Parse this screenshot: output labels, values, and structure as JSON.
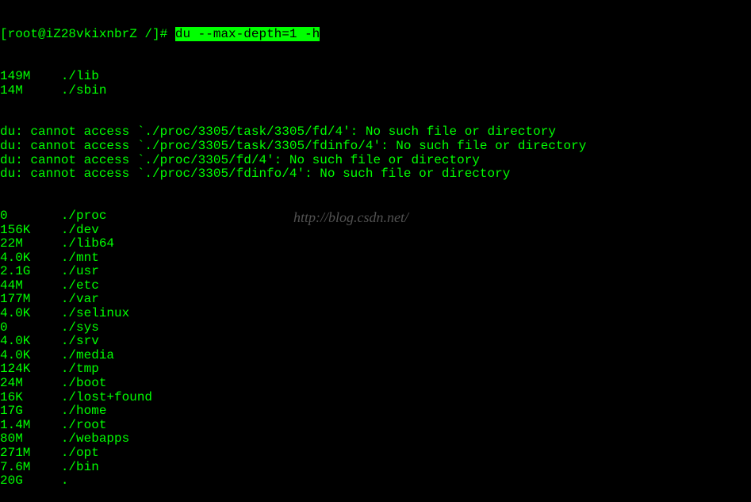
{
  "prompt": "[root@iZ28vkixnbrZ /]# ",
  "command": "du --max-depth=1 -h",
  "errors": [
    "du: cannot access `./proc/3305/task/3305/fd/4': No such file or directory",
    "du: cannot access `./proc/3305/task/3305/fdinfo/4': No such file or directory",
    "du: cannot access `./proc/3305/fd/4': No such file or directory",
    "du: cannot access `./proc/3305/fdinfo/4': No such file or directory"
  ],
  "entries": [
    {
      "size": "149M",
      "path": "./lib"
    },
    {
      "size": "14M",
      "path": "./sbin"
    }
  ],
  "entries2": [
    {
      "size": "0",
      "path": "./proc"
    },
    {
      "size": "156K",
      "path": "./dev"
    },
    {
      "size": "22M",
      "path": "./lib64"
    },
    {
      "size": "4.0K",
      "path": "./mnt"
    },
    {
      "size": "2.1G",
      "path": "./usr"
    },
    {
      "size": "44M",
      "path": "./etc"
    },
    {
      "size": "177M",
      "path": "./var"
    },
    {
      "size": "4.0K",
      "path": "./selinux"
    },
    {
      "size": "0",
      "path": "./sys"
    },
    {
      "size": "4.0K",
      "path": "./srv"
    },
    {
      "size": "4.0K",
      "path": "./media"
    },
    {
      "size": "124K",
      "path": "./tmp"
    },
    {
      "size": "24M",
      "path": "./boot"
    },
    {
      "size": "16K",
      "path": "./lost+found"
    },
    {
      "size": "17G",
      "path": "./home"
    },
    {
      "size": "1.4M",
      "path": "./root"
    },
    {
      "size": "80M",
      "path": "./webapps"
    },
    {
      "size": "271M",
      "path": "./opt"
    },
    {
      "size": "7.6M",
      "path": "./bin"
    },
    {
      "size": "20G",
      "path": "."
    }
  ],
  "watermark": "http://blog.csdn.net/"
}
